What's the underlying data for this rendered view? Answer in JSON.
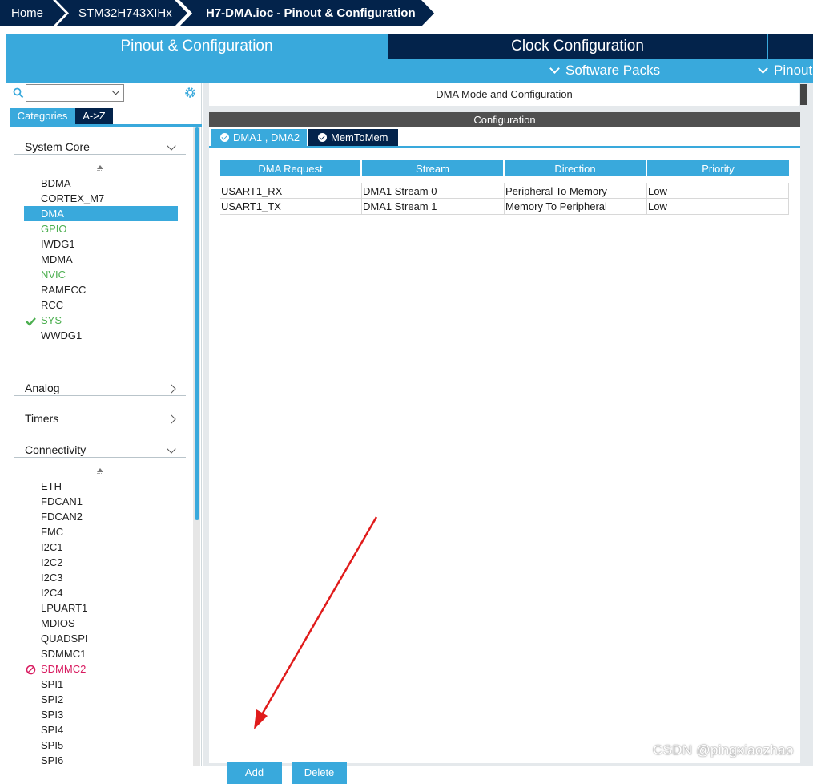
{
  "breadcrumb": [
    "Home",
    "STM32H743XIHx",
    "H7-DMA.ioc - Pinout & Configuration"
  ],
  "main_tabs": [
    {
      "label": "Pinout & Configuration",
      "active": true
    },
    {
      "label": "Clock Configuration",
      "active": false
    }
  ],
  "subbar": {
    "software_packs": "Software Packs",
    "pinout": "Pinout"
  },
  "left": {
    "category_tabs": [
      "Categories",
      "A->Z"
    ],
    "groups": [
      {
        "label": "System Core",
        "expanded": true,
        "items": [
          {
            "label": "BDMA",
            "state": "normal"
          },
          {
            "label": "CORTEX_M7",
            "state": "normal"
          },
          {
            "label": "DMA",
            "state": "selected"
          },
          {
            "label": "GPIO",
            "state": "green"
          },
          {
            "label": "IWDG1",
            "state": "normal"
          },
          {
            "label": "MDMA",
            "state": "normal"
          },
          {
            "label": "NVIC",
            "state": "green"
          },
          {
            "label": "RAMECC",
            "state": "normal"
          },
          {
            "label": "RCC",
            "state": "normal"
          },
          {
            "label": "SYS",
            "state": "checked"
          },
          {
            "label": "WWDG1",
            "state": "normal"
          }
        ]
      },
      {
        "label": "Analog",
        "expanded": false
      },
      {
        "label": "Timers",
        "expanded": false
      },
      {
        "label": "Connectivity",
        "expanded": true,
        "items": [
          {
            "label": "ETH",
            "state": "normal"
          },
          {
            "label": "FDCAN1",
            "state": "normal"
          },
          {
            "label": "FDCAN2",
            "state": "normal"
          },
          {
            "label": "FMC",
            "state": "normal"
          },
          {
            "label": "I2C1",
            "state": "normal"
          },
          {
            "label": "I2C2",
            "state": "normal"
          },
          {
            "label": "I2C3",
            "state": "normal"
          },
          {
            "label": "I2C4",
            "state": "normal"
          },
          {
            "label": "LPUART1",
            "state": "normal"
          },
          {
            "label": "MDIOS",
            "state": "normal"
          },
          {
            "label": "QUADSPI",
            "state": "normal"
          },
          {
            "label": "SDMMC1",
            "state": "normal"
          },
          {
            "label": "SDMMC2",
            "state": "disabled"
          },
          {
            "label": "SPI1",
            "state": "normal"
          },
          {
            "label": "SPI2",
            "state": "normal"
          },
          {
            "label": "SPI3",
            "state": "normal"
          },
          {
            "label": "SPI4",
            "state": "normal"
          },
          {
            "label": "SPI5",
            "state": "normal"
          },
          {
            "label": "SPI6",
            "state": "normal"
          }
        ]
      }
    ]
  },
  "right": {
    "mode_header": "DMA Mode and Configuration",
    "config_title": "Configuration",
    "subtabs": [
      "DMA1 , DMA2",
      "MemToMem"
    ],
    "table": {
      "columns": [
        "DMA Request",
        "Stream",
        "Direction",
        "Priority"
      ],
      "rows": [
        [
          "USART1_RX",
          "DMA1 Stream 0",
          "Peripheral To Memory",
          "Low"
        ],
        [
          "USART1_TX",
          "DMA1 Stream 1",
          "Memory To Peripheral",
          "Low"
        ]
      ]
    },
    "buttons": {
      "add": "Add",
      "delete": "Delete"
    }
  },
  "watermark": "CSDN @pingxiaozhao",
  "colors": {
    "accent": "#39a9dc",
    "navy": "#03234b",
    "green": "#4caf50",
    "disabled": "#d81b60",
    "annotation_arrow": "#e01b1b"
  }
}
